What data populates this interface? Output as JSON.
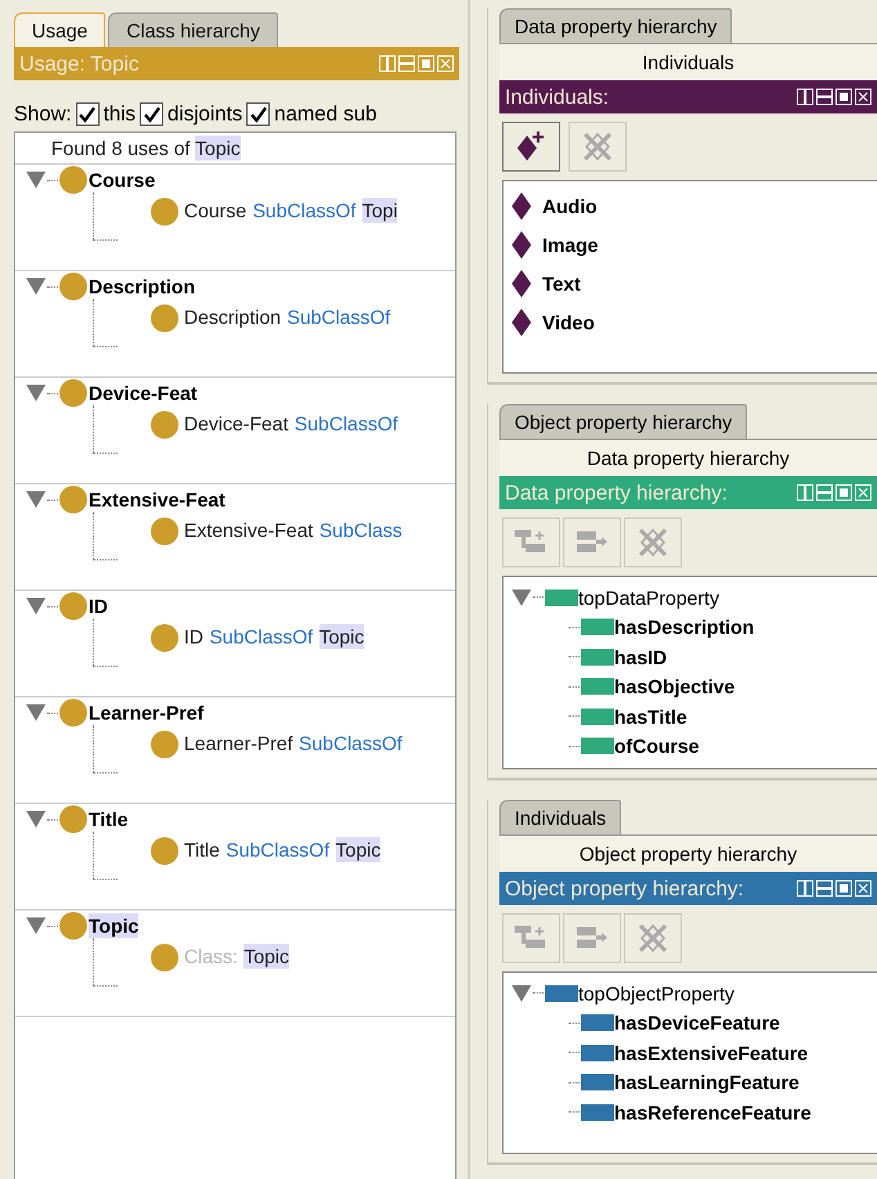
{
  "left": {
    "tabs": [
      {
        "label": "Usage",
        "selected": true
      },
      {
        "label": "Class hierarchy",
        "selected": false
      }
    ],
    "title": "Usage: Topic",
    "show": {
      "label": "Show:",
      "options": [
        {
          "label": "this",
          "checked": true
        },
        {
          "label": "disjoints",
          "checked": true
        },
        {
          "label": "named sub",
          "checked": true
        }
      ]
    },
    "found": {
      "text": "Found 8 uses of",
      "entity": "Topic"
    },
    "entries": [
      {
        "label": "Course",
        "match": false,
        "expanded": true,
        "axiom": [
          {
            "text": "Course",
            "kind": "name"
          },
          {
            "text": "SubClassOf",
            "kind": "keyword"
          },
          {
            "text": "Topi",
            "kind": "match"
          }
        ]
      },
      {
        "label": "Description",
        "match": false,
        "expanded": true,
        "axiom": [
          {
            "text": "Description",
            "kind": "name"
          },
          {
            "text": "SubClassOf",
            "kind": "keyword"
          }
        ]
      },
      {
        "label": "Device-Feat",
        "match": false,
        "expanded": true,
        "axiom": [
          {
            "text": "Device-Feat",
            "kind": "name"
          },
          {
            "text": "SubClassOf",
            "kind": "keyword"
          }
        ]
      },
      {
        "label": "Extensive-Feat",
        "match": false,
        "expanded": true,
        "axiom": [
          {
            "text": "Extensive-Feat",
            "kind": "name"
          },
          {
            "text": "SubClass",
            "kind": "keyword"
          }
        ]
      },
      {
        "label": "ID",
        "match": false,
        "expanded": true,
        "axiom": [
          {
            "text": "ID",
            "kind": "name"
          },
          {
            "text": "SubClassOf",
            "kind": "keyword"
          },
          {
            "text": "Topic",
            "kind": "match"
          }
        ]
      },
      {
        "label": "Learner-Pref",
        "match": false,
        "expanded": true,
        "axiom": [
          {
            "text": "Learner-Pref",
            "kind": "name"
          },
          {
            "text": "SubClassOf",
            "kind": "keyword"
          }
        ]
      },
      {
        "label": "Title",
        "match": false,
        "expanded": true,
        "axiom": [
          {
            "text": "Title",
            "kind": "name"
          },
          {
            "text": "SubClassOf",
            "kind": "keyword"
          },
          {
            "text": "Topic",
            "kind": "match"
          }
        ]
      },
      {
        "label": "Topic",
        "match": true,
        "expanded": true,
        "axiom": [
          {
            "text": "Class:",
            "kind": "muted"
          },
          {
            "text": "Topic",
            "kind": "match"
          }
        ]
      }
    ]
  },
  "panels": [
    {
      "kind": "individuals",
      "back_tab": "Data property hierarchy",
      "active_tab": "Individuals",
      "title": "Individuals:",
      "color": "#541a4e",
      "buttons": [
        {
          "kind": "add-individual",
          "disabled": false
        },
        {
          "kind": "delete",
          "disabled": true
        }
      ],
      "items": [
        {
          "label": "Audio"
        },
        {
          "label": "Image"
        },
        {
          "label": "Text"
        },
        {
          "label": "Video"
        }
      ]
    },
    {
      "kind": "data",
      "back_tab": "Object property hierarchy",
      "active_tab": "Data property hierarchy",
      "title": "Data property hierarchy:",
      "color": "#2eaa7c",
      "buttons": [
        {
          "kind": "add-sub",
          "disabled": true
        },
        {
          "kind": "add-sibling",
          "disabled": true
        },
        {
          "kind": "delete",
          "disabled": true
        }
      ],
      "tree": {
        "label": "topDataProperty",
        "expanded": true,
        "children": [
          {
            "label": "hasDescription"
          },
          {
            "label": "hasID"
          },
          {
            "label": "hasObjective"
          },
          {
            "label": "hasTitle"
          },
          {
            "label": "ofCourse"
          }
        ]
      }
    },
    {
      "kind": "object",
      "back_tab": "Individuals",
      "active_tab": "Object property hierarchy",
      "title": "Object property hierarchy:",
      "color": "#2f74a8",
      "buttons": [
        {
          "kind": "add-sub",
          "disabled": true
        },
        {
          "kind": "add-sibling",
          "disabled": true
        },
        {
          "kind": "delete",
          "disabled": true
        }
      ],
      "tree": {
        "label": "topObjectProperty",
        "expanded": true,
        "children": [
          {
            "label": "hasDeviceFeature"
          },
          {
            "label": "hasExtensiveFeature"
          },
          {
            "label": "hasLearningFeature"
          },
          {
            "label": "hasReferenceFeature"
          }
        ]
      }
    }
  ]
}
